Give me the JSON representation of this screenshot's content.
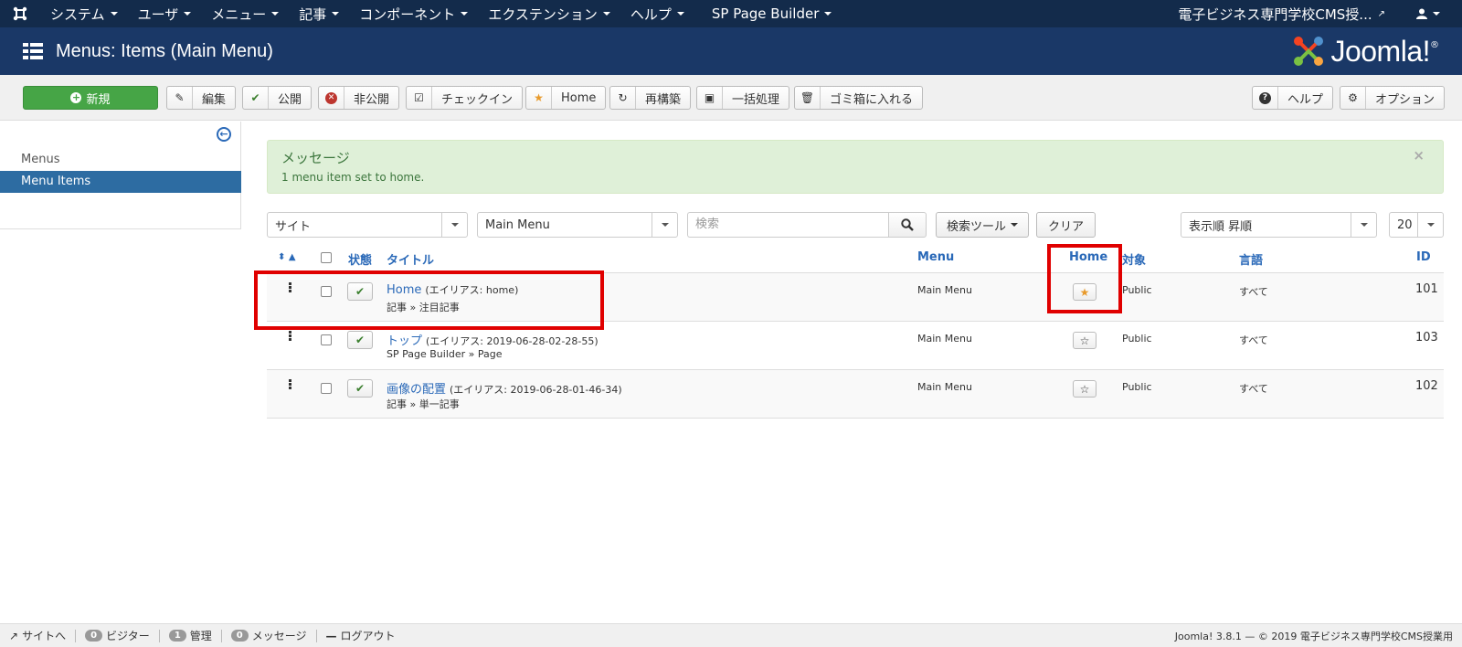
{
  "topnav": {
    "menus": [
      "システム",
      "ユーザ",
      "メニュー",
      "記事",
      "コンポーネント",
      "エクステンション",
      "ヘルプ",
      "SP Page Builder"
    ],
    "site_name": "電子ビジネス専門学校CMS授...",
    "user_icon": "user-icon"
  },
  "header": {
    "title": "Menus: Items (Main Menu)",
    "brand": "Joomla!",
    "brand_mark": "®"
  },
  "toolbar": {
    "new": "新規",
    "edit": "編集",
    "publish": "公開",
    "unpublish": "非公開",
    "checkin": "チェックイン",
    "home": "Home",
    "rebuild": "再構築",
    "batch": "一括処理",
    "trash": "ゴミ箱に入れる",
    "help": "ヘルプ",
    "options": "オプション"
  },
  "sidebar": {
    "items": [
      {
        "label": "Menus",
        "active": false
      },
      {
        "label": "Menu Items",
        "active": true
      }
    ]
  },
  "message": {
    "title": "メッセージ",
    "text": "1 menu item set to home.",
    "close": "×"
  },
  "filters": {
    "client": "サイト",
    "menu": "Main Menu",
    "search_placeholder": "検索",
    "search_tools": "検索ツール",
    "clear": "クリア",
    "ordering": "表示順 昇順",
    "limit": "20"
  },
  "table": {
    "headers": {
      "sort": "⬍ ▲",
      "status": "状態",
      "title": "タイトル",
      "menu": "Menu",
      "home": "Home",
      "access": "対象",
      "language": "言語",
      "id": "ID"
    },
    "rows": [
      {
        "title": "Home",
        "alias": "(エイリアス: home)",
        "type": "記事 » 注目記事",
        "menu": "Main Menu",
        "home": true,
        "access": "Public",
        "language": "すべて",
        "id": "101"
      },
      {
        "title": "トップ",
        "alias": "(エイリアス: 2019-06-28-02-28-55)",
        "type": "SP Page Builder » Page",
        "menu": "Main Menu",
        "home": false,
        "access": "Public",
        "language": "すべて",
        "id": "103"
      },
      {
        "title": "画像の配置",
        "alias": "(エイリアス: 2019-06-28-01-46-34)",
        "type": "記事 » 単一記事",
        "menu": "Main Menu",
        "home": false,
        "access": "Public",
        "language": "すべて",
        "id": "102"
      }
    ]
  },
  "footer": {
    "view_site": "サイトへ",
    "visitors_count": "0",
    "visitors": "ビジター",
    "admins_count": "1",
    "admins": "管理",
    "messages_count": "0",
    "messages": "メッセージ",
    "logout": "ログアウト",
    "version": "Joomla! 3.8.1 — © 2019 電子ビジネス専門学校CMS授業用"
  },
  "colors": {
    "navbar": "#132b4b",
    "header": "#1a3867",
    "new_button": "#46a546",
    "link": "#2a69b8",
    "highlight": "#e00000",
    "star": "#e89a2b"
  }
}
